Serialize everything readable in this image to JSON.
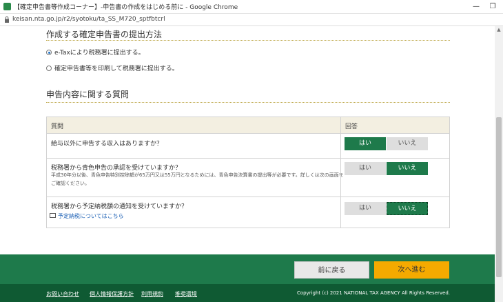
{
  "window": {
    "title": "【確定申告書等作成コーナー】-申告書の作成をはじめる前に - Google Chrome",
    "minimize_glyph": "—",
    "restore_glyph": "❐",
    "url": "keisan.nta.go.jp/r2/syotoku/ta_SS_M720_sptfbtcrl"
  },
  "filing_method": {
    "heading": "作成する確定申告書の提出方法",
    "options": [
      {
        "label": "e-Taxにより税務署に提出する。",
        "selected": true
      },
      {
        "label": "確定申告書等を印刷して税務署に提出する。",
        "selected": false
      }
    ]
  },
  "questions_section": {
    "heading": "申告内容に関する質問",
    "table": {
      "header_question": "質問",
      "header_answer": "回答",
      "rows": [
        {
          "question": "給与以外に申告する収入はありますか？",
          "yes_label": "はい",
          "no_label": "いいえ",
          "answer": "yes"
        },
        {
          "question": "税務署から青色申告の承認を受けていますか？",
          "note_line1": "平成30年分以後、青色申告特別控除額が65万円又は55万円となるためには、青色申告決算書の提出等が必要です。詳しくは次の画面を",
          "note_line2": "ご確認ください。",
          "yes_label": "はい",
          "no_label": "いいえ",
          "answer": "no"
        },
        {
          "question": "税務署から予定納税額の通知を受けていますか？",
          "link": "予定納税についてはこちら",
          "yes_label": "はい",
          "no_label": "いいえ",
          "answer": "no"
        }
      ]
    }
  },
  "footer": {
    "back_button": "前に戻る",
    "next_button": "次へ進む",
    "links": [
      "お問い合わせ",
      "個人情報保護方針",
      "利用規約",
      "推奨環境"
    ],
    "copyright": "Copyright (c) 2021 NATIONAL TAX AGENCY All Rights Reserved."
  },
  "colors": {
    "brand_green": "#1e7a4b",
    "footer_dark": "#0f5a33",
    "next_button": "#f5aa00",
    "section_rule": "#b8a03a"
  }
}
